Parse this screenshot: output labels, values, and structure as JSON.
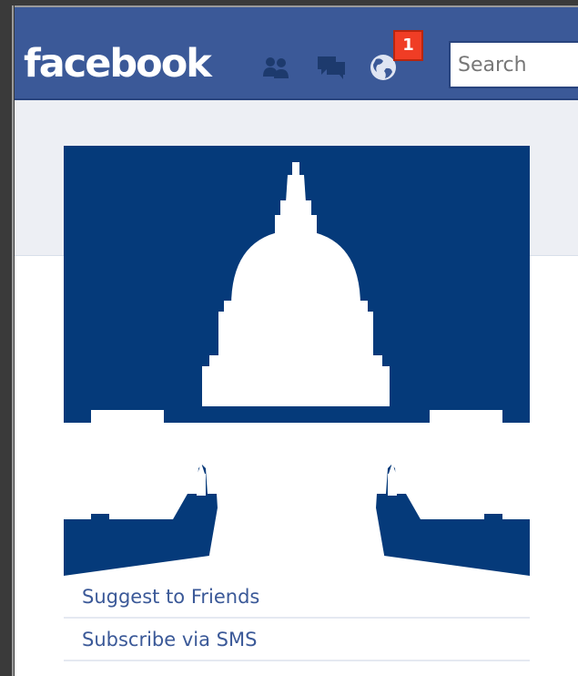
{
  "header": {
    "logo_text": "facebook",
    "notification_count": "1",
    "search": {
      "placeholder": "Search",
      "value": ""
    },
    "icons": [
      "friend-requests-icon",
      "messages-icon",
      "notifications-globe-icon"
    ],
    "colors": {
      "bluebar": "#3b5998",
      "badge": "#f03d25",
      "link": "#3b5998"
    }
  },
  "profile": {
    "picture_icon": "capitol-dome-silhouette",
    "picture_colors": {
      "background": "#053a7a",
      "silhouette": "#ffffff"
    }
  },
  "links": [
    {
      "label": "Suggest to Friends"
    },
    {
      "label": "Subscribe via SMS"
    }
  ],
  "left_edge_text": "!"
}
